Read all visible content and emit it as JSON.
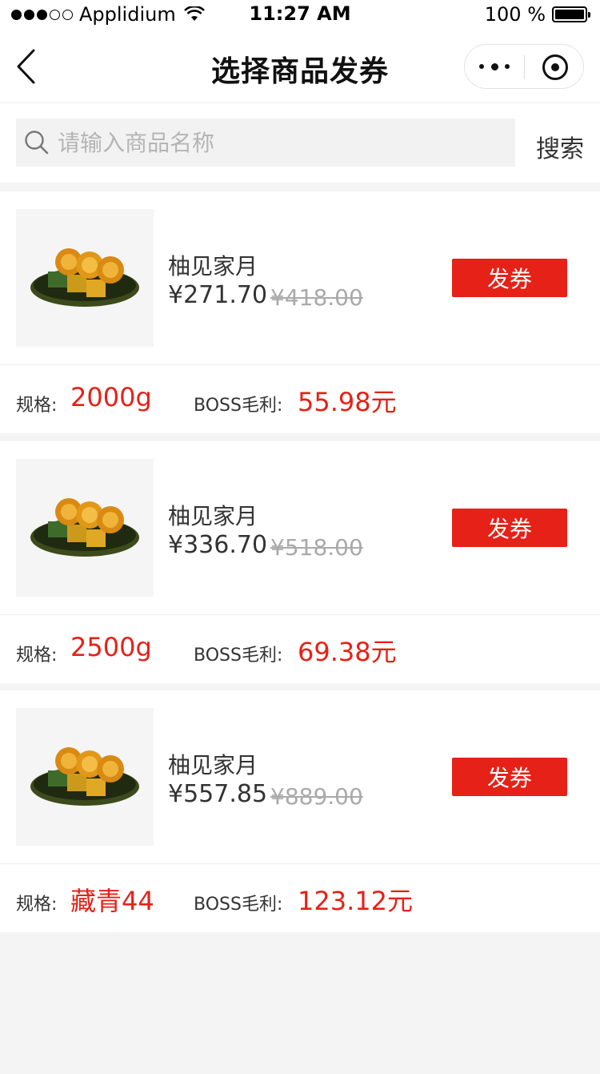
{
  "status_bar": {
    "carrier": "Applidium",
    "time": "11:27 AM",
    "battery": "100 %"
  },
  "nav": {
    "title": "选择商品发券"
  },
  "search": {
    "placeholder": "请输入商品名称",
    "value": "",
    "button_label": "搜索"
  },
  "products": [
    {
      "name": "柚见家月",
      "price": "¥271.70",
      "original_price": "¥418.00",
      "coupon_label": "发券",
      "spec_label": "规格:",
      "spec": "2000g",
      "profit_label": "BOSS毛利:",
      "profit": "55.98元"
    },
    {
      "name": "柚见家月",
      "price": "¥336.70",
      "original_price": "¥518.00",
      "coupon_label": "发券",
      "spec_label": "规格:",
      "spec": "2500g",
      "profit_label": "BOSS毛利:",
      "profit": "69.38元"
    },
    {
      "name": "柚见家月",
      "price": "¥557.85",
      "original_price": "¥889.00",
      "coupon_label": "发券",
      "spec_label": "规格:",
      "spec": "藏青44",
      "profit_label": "BOSS毛利:",
      "profit": "123.12元"
    }
  ],
  "colors": {
    "accent": "#e62117",
    "background": "#f4f4f4"
  }
}
